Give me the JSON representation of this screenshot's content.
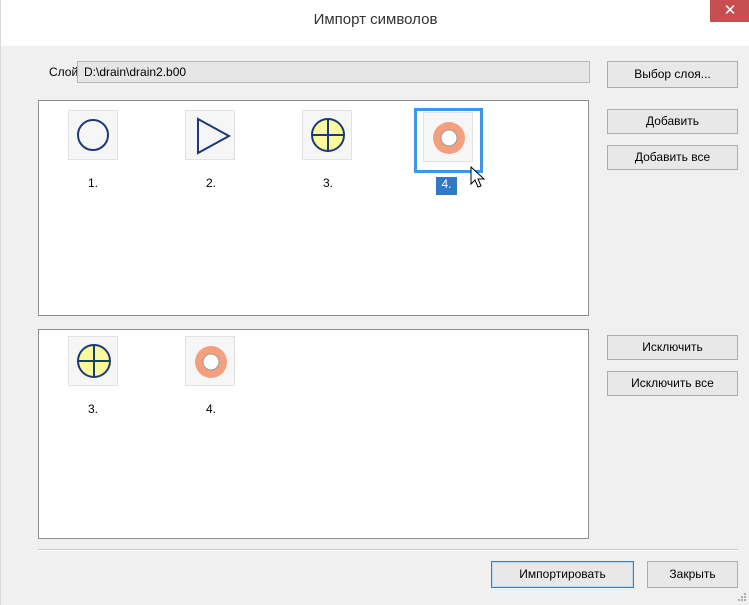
{
  "window": {
    "title": "Импорт символов",
    "close_icon": "close-icon"
  },
  "layer": {
    "label": "Слой:",
    "value": "D:\\drain\\drain2.b00",
    "select_button": "Выбор слоя..."
  },
  "buttons": {
    "add": "Добавить",
    "add_all": "Добавить все",
    "exclude": "Исключить",
    "exclude_all": "Исключить все",
    "import": "Импортировать",
    "close": "Закрыть"
  },
  "available_symbols": [
    {
      "label": "1.",
      "icon": "circle-icon",
      "selected": false
    },
    {
      "label": "2.",
      "icon": "triangle-icon",
      "selected": false
    },
    {
      "label": "3.",
      "icon": "crossed-circle-icon",
      "selected": false
    },
    {
      "label": "4.",
      "icon": "ring-icon",
      "selected": true
    }
  ],
  "chosen_symbols": [
    {
      "label": "3.",
      "icon": "crossed-circle-icon"
    },
    {
      "label": "4.",
      "icon": "ring-icon"
    }
  ],
  "colors": {
    "selection": "#3e96e6",
    "ring": "#f4a07e",
    "crossed_fill": "#fafa9c",
    "stroke": "#1c3a78"
  }
}
